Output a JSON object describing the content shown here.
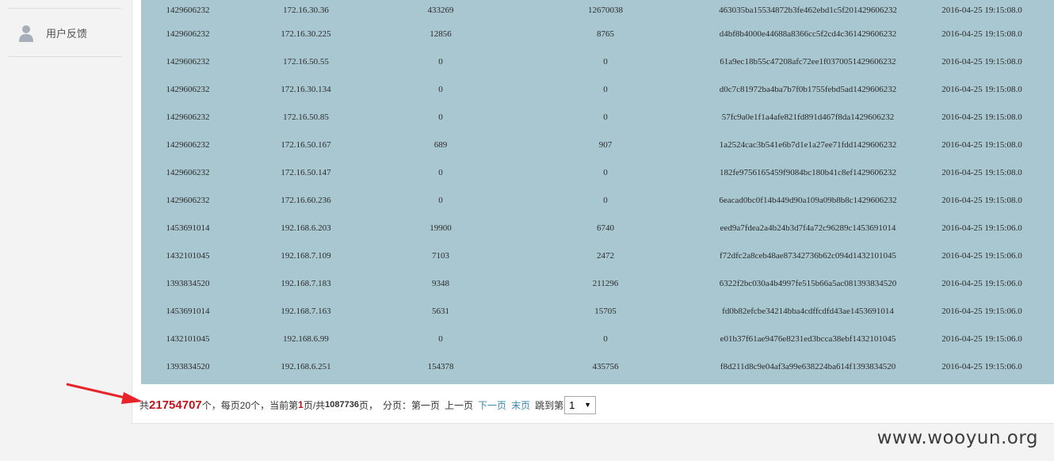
{
  "sidebar": {
    "items": [
      {
        "label": "用户反馈",
        "icon": "user-icon"
      }
    ]
  },
  "table": {
    "rows": [
      [
        "1429606232",
        "172.16.30.36",
        "433269",
        "12670038",
        "463035ba15534872b3fe462ebd1c5f201429606232",
        "2016-04-25 19:15:08.0"
      ],
      [
        "1429606232",
        "172.16.30.225",
        "12856",
        "8765",
        "d4bf8b4000e44688a8366cc5f2cd4c361429606232",
        "2016-04-25 19:15:08.0"
      ],
      [
        "1429606232",
        "172.16.50.55",
        "0",
        "0",
        "61a9ec18b55c47208afc72ee1f0370051429606232",
        "2016-04-25 19:15:08.0"
      ],
      [
        "1429606232",
        "172.16.30.134",
        "0",
        "0",
        "d0c7c81972ba4ba7b7f0b1755febd5ad1429606232",
        "2016-04-25 19:15:08.0"
      ],
      [
        "1429606232",
        "172.16.50.85",
        "0",
        "0",
        "57fc9a0e1f1a4afe821fd891d467f8da1429606232",
        "2016-04-25 19:15:08.0"
      ],
      [
        "1429606232",
        "172.16.50.167",
        "689",
        "907",
        "1a2524cac3b541e6b7d1e1a27ee71fdd1429606232",
        "2016-04-25 19:15:08.0"
      ],
      [
        "1429606232",
        "172.16.50.147",
        "0",
        "0",
        "182fe9756165459f9084bc180b41c8ef1429606232",
        "2016-04-25 19:15:08.0"
      ],
      [
        "1429606232",
        "172.16.60.236",
        "0",
        "0",
        "6eacad0bc0f14b449d90a109a09b8b8c1429606232",
        "2016-04-25 19:15:08.0"
      ],
      [
        "1453691014",
        "192.168.6.203",
        "19900",
        "6740",
        "eed9a7fdea2a4b24b3d7f4a72c96289c1453691014",
        "2016-04-25 19:15:06.0"
      ],
      [
        "1432101045",
        "192.168.7.109",
        "7103",
        "2472",
        "f72dfc2a8ceb48ae87342736b62c094d1432101045",
        "2016-04-25 19:15:06.0"
      ],
      [
        "1393834520",
        "192.168.7.183",
        "9348",
        "211296",
        "6322f2bc030a4b4997fe515b66a5ac081393834520",
        "2016-04-25 19:15:06.0"
      ],
      [
        "1453691014",
        "192.168.7.163",
        "5631",
        "15705",
        "fd0b82efcbe34214bba4cdffcdfd43ae1453691014",
        "2016-04-25 19:15:06.0"
      ],
      [
        "1432101045",
        "192.168.6.99",
        "0",
        "0",
        "e01b37f61ae9476e8231ed3bcca38ebf1432101045",
        "2016-04-25 19:15:06.0"
      ],
      [
        "1393834520",
        "192.168.6.251",
        "154378",
        "435756",
        "f8d211d8c9e04af3a99e638224ba614f1393834520",
        "2016-04-25 19:15:06.0"
      ]
    ]
  },
  "pager": {
    "prefix": "共",
    "total": "21754707",
    "after_total": "个，每页20个，当前第",
    "current_page": "1",
    "after_current": "页/共",
    "total_pages": "1087736",
    "after_pages": "页，",
    "label": "分页：",
    "first": "第一页",
    "prev": "上一页",
    "next": "下一页",
    "last": "末页",
    "jump_label": "跳到第",
    "jump_value": "1"
  },
  "annotation": {
    "arrow_color": "#e8242a"
  },
  "watermark": "www.wooyun.org"
}
